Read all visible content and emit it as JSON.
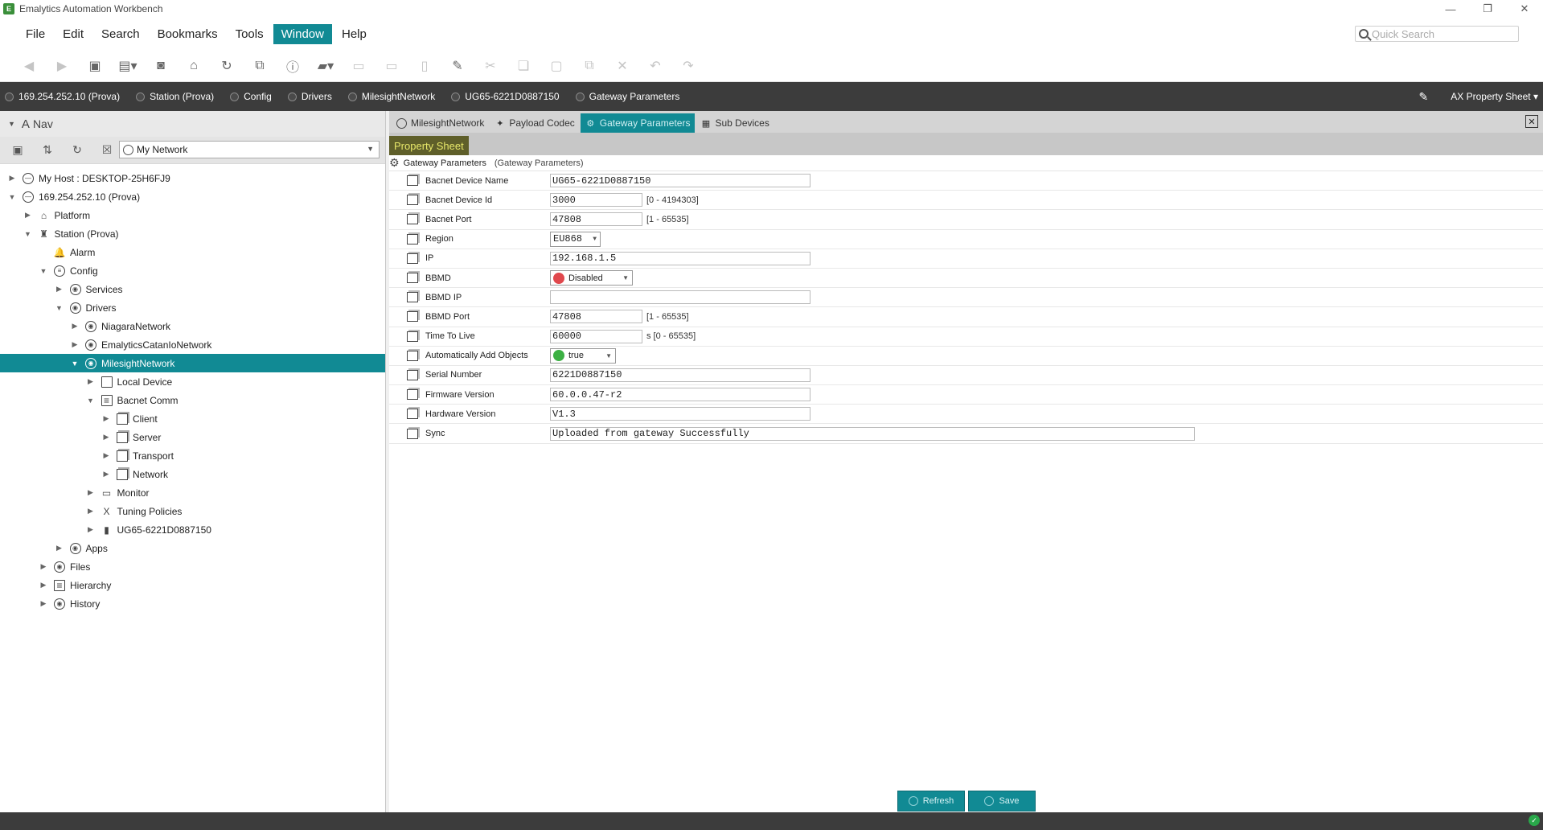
{
  "window": {
    "title": "Emalytics Automation Workbench",
    "app_icon_glyph": "E",
    "controls": [
      "—",
      "❐",
      "✕"
    ]
  },
  "menu": [
    "File",
    "Edit",
    "Search",
    "Bookmarks",
    "Tools",
    "Window",
    "Help"
  ],
  "active_menu": "Window",
  "quick_search": {
    "placeholder": "Quick Search"
  },
  "locator": {
    "items": [
      "169.254.252.10 (Prova)",
      "Station (Prova)",
      "Config",
      "Drivers",
      "MilesightNetwork",
      "UG65-6221D0887150",
      "Gateway Parameters"
    ],
    "view_selector": "AX Property Sheet"
  },
  "nav": {
    "title": "Nav",
    "selector": "My Network",
    "tree": [
      {
        "label": "My Host : DESKTOP-25H6FJ9",
        "depth": 0,
        "expanded": false,
        "icon": "host"
      },
      {
        "label": "169.254.252.10 (Prova)",
        "depth": 0,
        "expanded": true,
        "icon": "host"
      },
      {
        "label": "Platform",
        "depth": 1,
        "expanded": false,
        "icon": "platform"
      },
      {
        "label": "Station (Prova)",
        "depth": 1,
        "expanded": true,
        "icon": "station"
      },
      {
        "label": "Alarm",
        "depth": 2,
        "expanded": null,
        "icon": "bell"
      },
      {
        "label": "Config",
        "depth": 2,
        "expanded": true,
        "icon": "config"
      },
      {
        "label": "Services",
        "depth": 3,
        "expanded": false,
        "icon": "circle"
      },
      {
        "label": "Drivers",
        "depth": 3,
        "expanded": true,
        "icon": "circle"
      },
      {
        "label": "NiagaraNetwork",
        "depth": 4,
        "expanded": false,
        "icon": "circle"
      },
      {
        "label": "EmalyticsCatanIoNetwork",
        "depth": 4,
        "expanded": false,
        "icon": "circle"
      },
      {
        "label": "MilesightNetwork",
        "depth": 4,
        "expanded": true,
        "icon": "circle",
        "selected": true
      },
      {
        "label": "Local Device",
        "depth": 5,
        "expanded": false,
        "icon": "device"
      },
      {
        "label": "Bacnet Comm",
        "depth": 5,
        "expanded": true,
        "icon": "folder"
      },
      {
        "label": "Client",
        "depth": 6,
        "expanded": false,
        "icon": "box"
      },
      {
        "label": "Server",
        "depth": 6,
        "expanded": false,
        "icon": "box"
      },
      {
        "label": "Transport",
        "depth": 6,
        "expanded": false,
        "icon": "box"
      },
      {
        "label": "Network",
        "depth": 6,
        "expanded": false,
        "icon": "box"
      },
      {
        "label": "Monitor",
        "depth": 5,
        "expanded": false,
        "icon": "monitor"
      },
      {
        "label": "Tuning Policies",
        "depth": 5,
        "expanded": false,
        "icon": "tuning"
      },
      {
        "label": "UG65-6221D0887150",
        "depth": 5,
        "expanded": false,
        "icon": "gateway"
      },
      {
        "label": "Apps",
        "depth": 3,
        "expanded": false,
        "icon": "circle"
      },
      {
        "label": "Files",
        "depth": 2,
        "expanded": false,
        "icon": "circle"
      },
      {
        "label": "Hierarchy",
        "depth": 2,
        "expanded": false,
        "icon": "folder"
      },
      {
        "label": "History",
        "depth": 2,
        "expanded": false,
        "icon": "circle"
      }
    ]
  },
  "tabs": [
    {
      "label": "MilesightNetwork",
      "icon": "circle"
    },
    {
      "label": "Payload Codec",
      "icon": "puzzle"
    },
    {
      "label": "Gateway Parameters",
      "icon": "gear",
      "active": true
    },
    {
      "label": "Sub Devices",
      "icon": "grid"
    }
  ],
  "property_sheet": {
    "title": "Property Sheet",
    "root_label": "Gateway Parameters",
    "root_type": "(Gateway Parameters)",
    "rows": [
      {
        "label": "Bacnet Device Name",
        "kind": "text",
        "value": "UG65-6221D0887150",
        "width": "wide"
      },
      {
        "label": "Bacnet Device Id",
        "kind": "text",
        "value": "3000",
        "width": "short",
        "range": "[0 - 4194303]"
      },
      {
        "label": "Bacnet Port",
        "kind": "text",
        "value": "47808",
        "width": "short",
        "range": "[1 - 65535]"
      },
      {
        "label": "Region",
        "kind": "select",
        "value": "EU868",
        "mono": true
      },
      {
        "label": "IP",
        "kind": "text",
        "value": "192.168.1.5",
        "width": "wide"
      },
      {
        "label": "BBMD",
        "kind": "select",
        "value": "Disabled",
        "dot": "#e0484d"
      },
      {
        "label": "BBMD IP",
        "kind": "text",
        "value": "",
        "width": "wide"
      },
      {
        "label": "BBMD Port",
        "kind": "text",
        "value": "47808",
        "width": "short",
        "range": "[1 - 65535]"
      },
      {
        "label": "Time To Live",
        "kind": "text",
        "value": "60000",
        "width": "short",
        "range": "s [0 - 65535]"
      },
      {
        "label": "Automatically Add Objects",
        "kind": "select",
        "value": "true",
        "dot": "#3cb043"
      },
      {
        "label": "Serial Number",
        "kind": "text",
        "value": "6221D0887150",
        "width": "wide"
      },
      {
        "label": "Firmware Version",
        "kind": "text",
        "value": "60.0.0.47-r2",
        "width": "wide"
      },
      {
        "label": "Hardware Version",
        "kind": "text",
        "value": "V1.3",
        "width": "wide"
      },
      {
        "label": "Sync",
        "kind": "text",
        "value": "Uploaded from gateway Successfully",
        "width": "xwide"
      }
    ]
  },
  "buttons": {
    "refresh": "Refresh",
    "save": "Save"
  },
  "colors": {
    "accent": "#118a94",
    "locator_bg": "#3c3c3c",
    "ps_title_bg": "#5f5f2a",
    "ps_title_fg": "#e8e86a"
  }
}
